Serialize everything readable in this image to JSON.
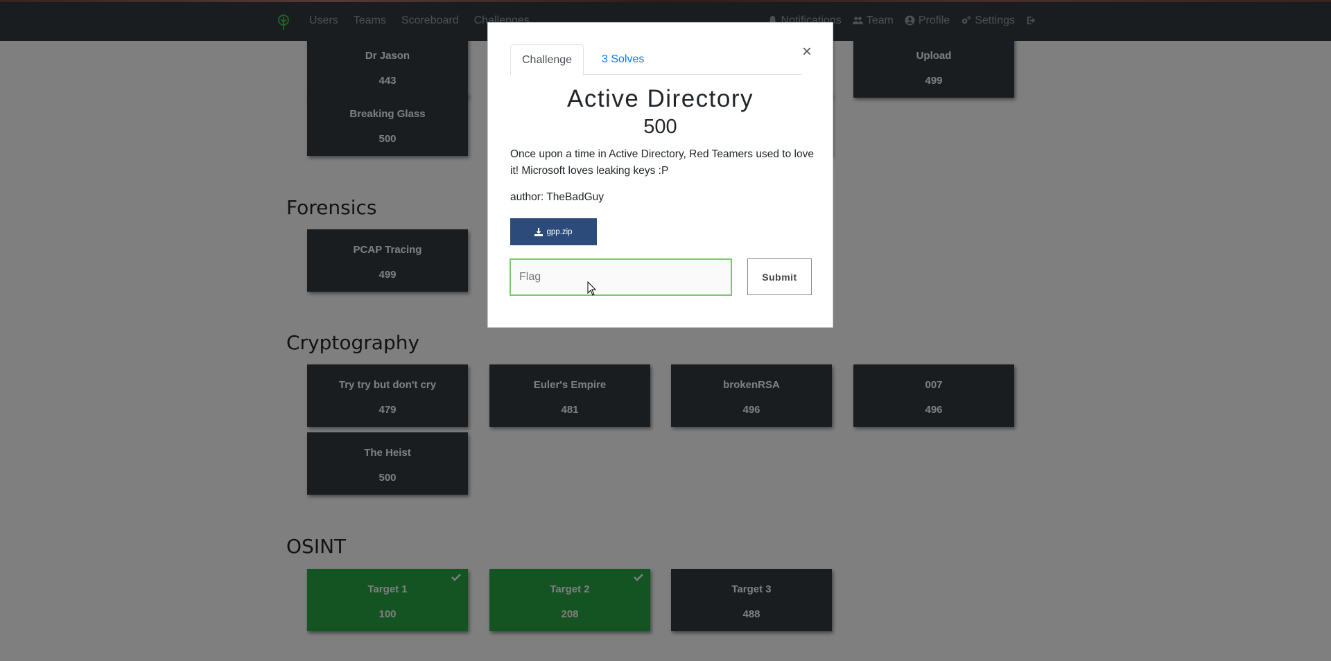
{
  "navbar": {
    "left_links": [
      "Users",
      "Teams",
      "Scoreboard",
      "Challenges"
    ],
    "right_links": [
      {
        "label": "Notifications",
        "icon": "bell-icon"
      },
      {
        "label": "Team",
        "icon": "users-icon"
      },
      {
        "label": "Profile",
        "icon": "user-circle-icon"
      },
      {
        "label": "Settings",
        "icon": "cogs-icon"
      },
      {
        "label": "",
        "icon": "logout-icon"
      }
    ]
  },
  "categories": [
    {
      "title": "",
      "cards": [
        {
          "name": "Dr Jason",
          "value": "443",
          "solved": false
        },
        {
          "name": "",
          "value": "",
          "solved": false
        },
        {
          "name": "",
          "value": "",
          "solved": false
        },
        {
          "name": "Upload",
          "value": "499",
          "solved": false
        },
        {
          "name": "Breaking Glass",
          "value": "500",
          "solved": false
        },
        {
          "name": "",
          "value": "",
          "solved": false
        },
        {
          "name": "",
          "value": "",
          "solved": false
        }
      ]
    },
    {
      "title": "Forensics",
      "cards": [
        {
          "name": "PCAP Tracing",
          "value": "499",
          "solved": false
        },
        {
          "name": "",
          "value": "",
          "solved": false
        }
      ]
    },
    {
      "title": "Cryptography",
      "cards": [
        {
          "name": "Try try but don't cry",
          "value": "479",
          "solved": false
        },
        {
          "name": "Euler's Empire",
          "value": "481",
          "solved": false
        },
        {
          "name": "brokenRSA",
          "value": "496",
          "solved": false
        },
        {
          "name": "007",
          "value": "496",
          "solved": false
        },
        {
          "name": "The Heist",
          "value": "500",
          "solved": false
        }
      ]
    },
    {
      "title": "OSINT",
      "cards": [
        {
          "name": "Target 1",
          "value": "100",
          "solved": true
        },
        {
          "name": "Target 2",
          "value": "208",
          "solved": true
        },
        {
          "name": "Target 3",
          "value": "488",
          "solved": false
        }
      ]
    }
  ],
  "modal": {
    "tabs": [
      "Challenge",
      "3 Solves"
    ],
    "close_label": "×",
    "title": "Active Directory",
    "value": "500",
    "description": "Once upon a time in Active Directory, Red Teamers used to love it! Microsoft loves leaking keys :P",
    "author": "author: TheBadGuy",
    "file": {
      "label": "gpp.zip",
      "icon": "download-icon"
    },
    "flag_placeholder": "Flag",
    "flag_value": "",
    "submit_label": "Submit"
  },
  "colors": {
    "navbar": "#343a40",
    "card": "#343a40",
    "solved_card": "#28a745",
    "file_button": "#2c4b7a",
    "link": "#007bff",
    "input_border": "#7bc86c"
  }
}
